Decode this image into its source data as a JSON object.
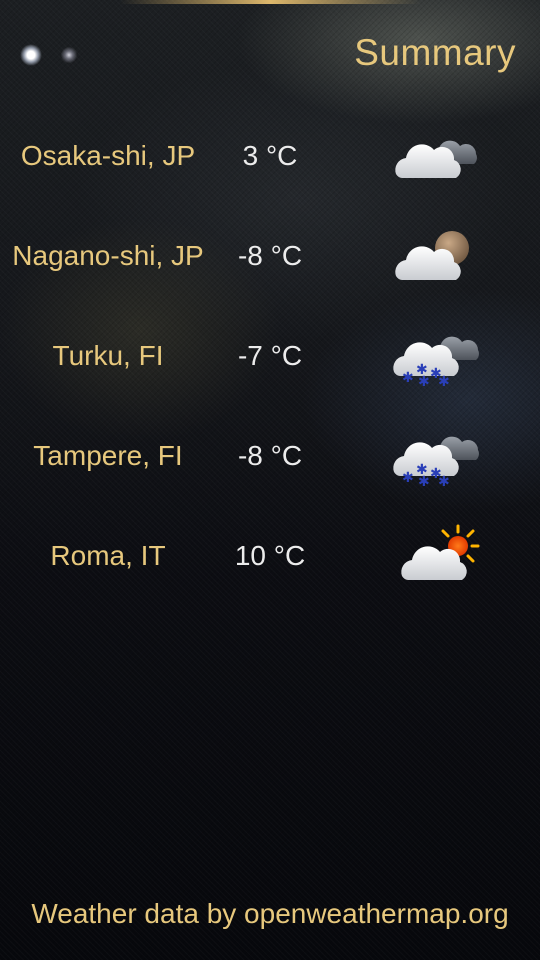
{
  "header": {
    "title": "Summary",
    "page_indicator": {
      "pages": 2,
      "active": 1
    }
  },
  "cities": [
    {
      "name": "Osaka-shi, JP",
      "temperature": "3 °C",
      "icon": "cloudy-icon"
    },
    {
      "name": "Nagano-shi, JP",
      "temperature": "-8 °C",
      "icon": "cloudy-night-icon"
    },
    {
      "name": "Turku, FI",
      "temperature": "-7 °C",
      "icon": "snow-icon"
    },
    {
      "name": "Tampere, FI",
      "temperature": "-8 °C",
      "icon": "snow-icon"
    },
    {
      "name": "Roma, IT",
      "temperature": "10 °C",
      "icon": "partly-sunny-icon"
    }
  ],
  "footer": {
    "credit": "Weather data by openweathermap.org"
  },
  "colors": {
    "accent": "#e7c87d",
    "text": "#ececec",
    "background": "#0b0c12"
  }
}
